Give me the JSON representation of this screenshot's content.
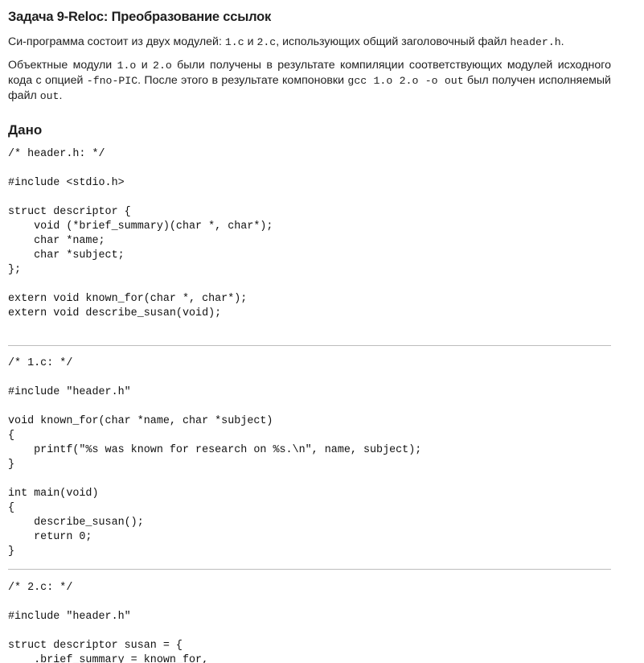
{
  "title": "Задача 9-Reloc: Преобразование ссылок",
  "intro": {
    "p1_a": "Си-программа состоит из двух модулей: ",
    "p1_file1": "1.c",
    "p1_b": " и ",
    "p1_file2": "2.c",
    "p1_c": ", использующих общий заголовочный файл ",
    "p1_header": "header.h",
    "p1_d": ".",
    "p2_a": "Объектные модули ",
    "p2_obj1": "1.o",
    "p2_b": " и ",
    "p2_obj2": "2.o",
    "p2_c": " были получены в результате компиляции соответствующих модулей исходного кода с опцией ",
    "p2_flag": "-fno-PIC",
    "p2_d": ". После этого в результате компоновки ",
    "p2_cmd": "gcc 1.o 2.o -o out",
    "p2_e": " был получен исполняемый файл ",
    "p2_exe": "out",
    "p2_f": "."
  },
  "given_heading": "Дано",
  "code_blocks": {
    "header_h": "/* header.h: */\n\n#include <stdio.h>\n\nstruct descriptor {\n    void (*brief_summary)(char *, char*);\n    char *name;\n    char *subject;\n};\n\nextern void known_for(char *, char*);\nextern void describe_susan(void);",
    "file_1c": "/* 1.c: */\n\n#include \"header.h\"\n\nvoid known_for(char *name, char *subject)\n{\n    printf(\"%s was known for research on %s.\\n\", name, subject);\n}\n\nint main(void)\n{\n    describe_susan();\n    return 0;\n}",
    "file_2c": "/* 2.c: */\n\n#include \"header.h\"\n\nstruct descriptor susan = {\n    .brief_summary = known_for,"
  }
}
